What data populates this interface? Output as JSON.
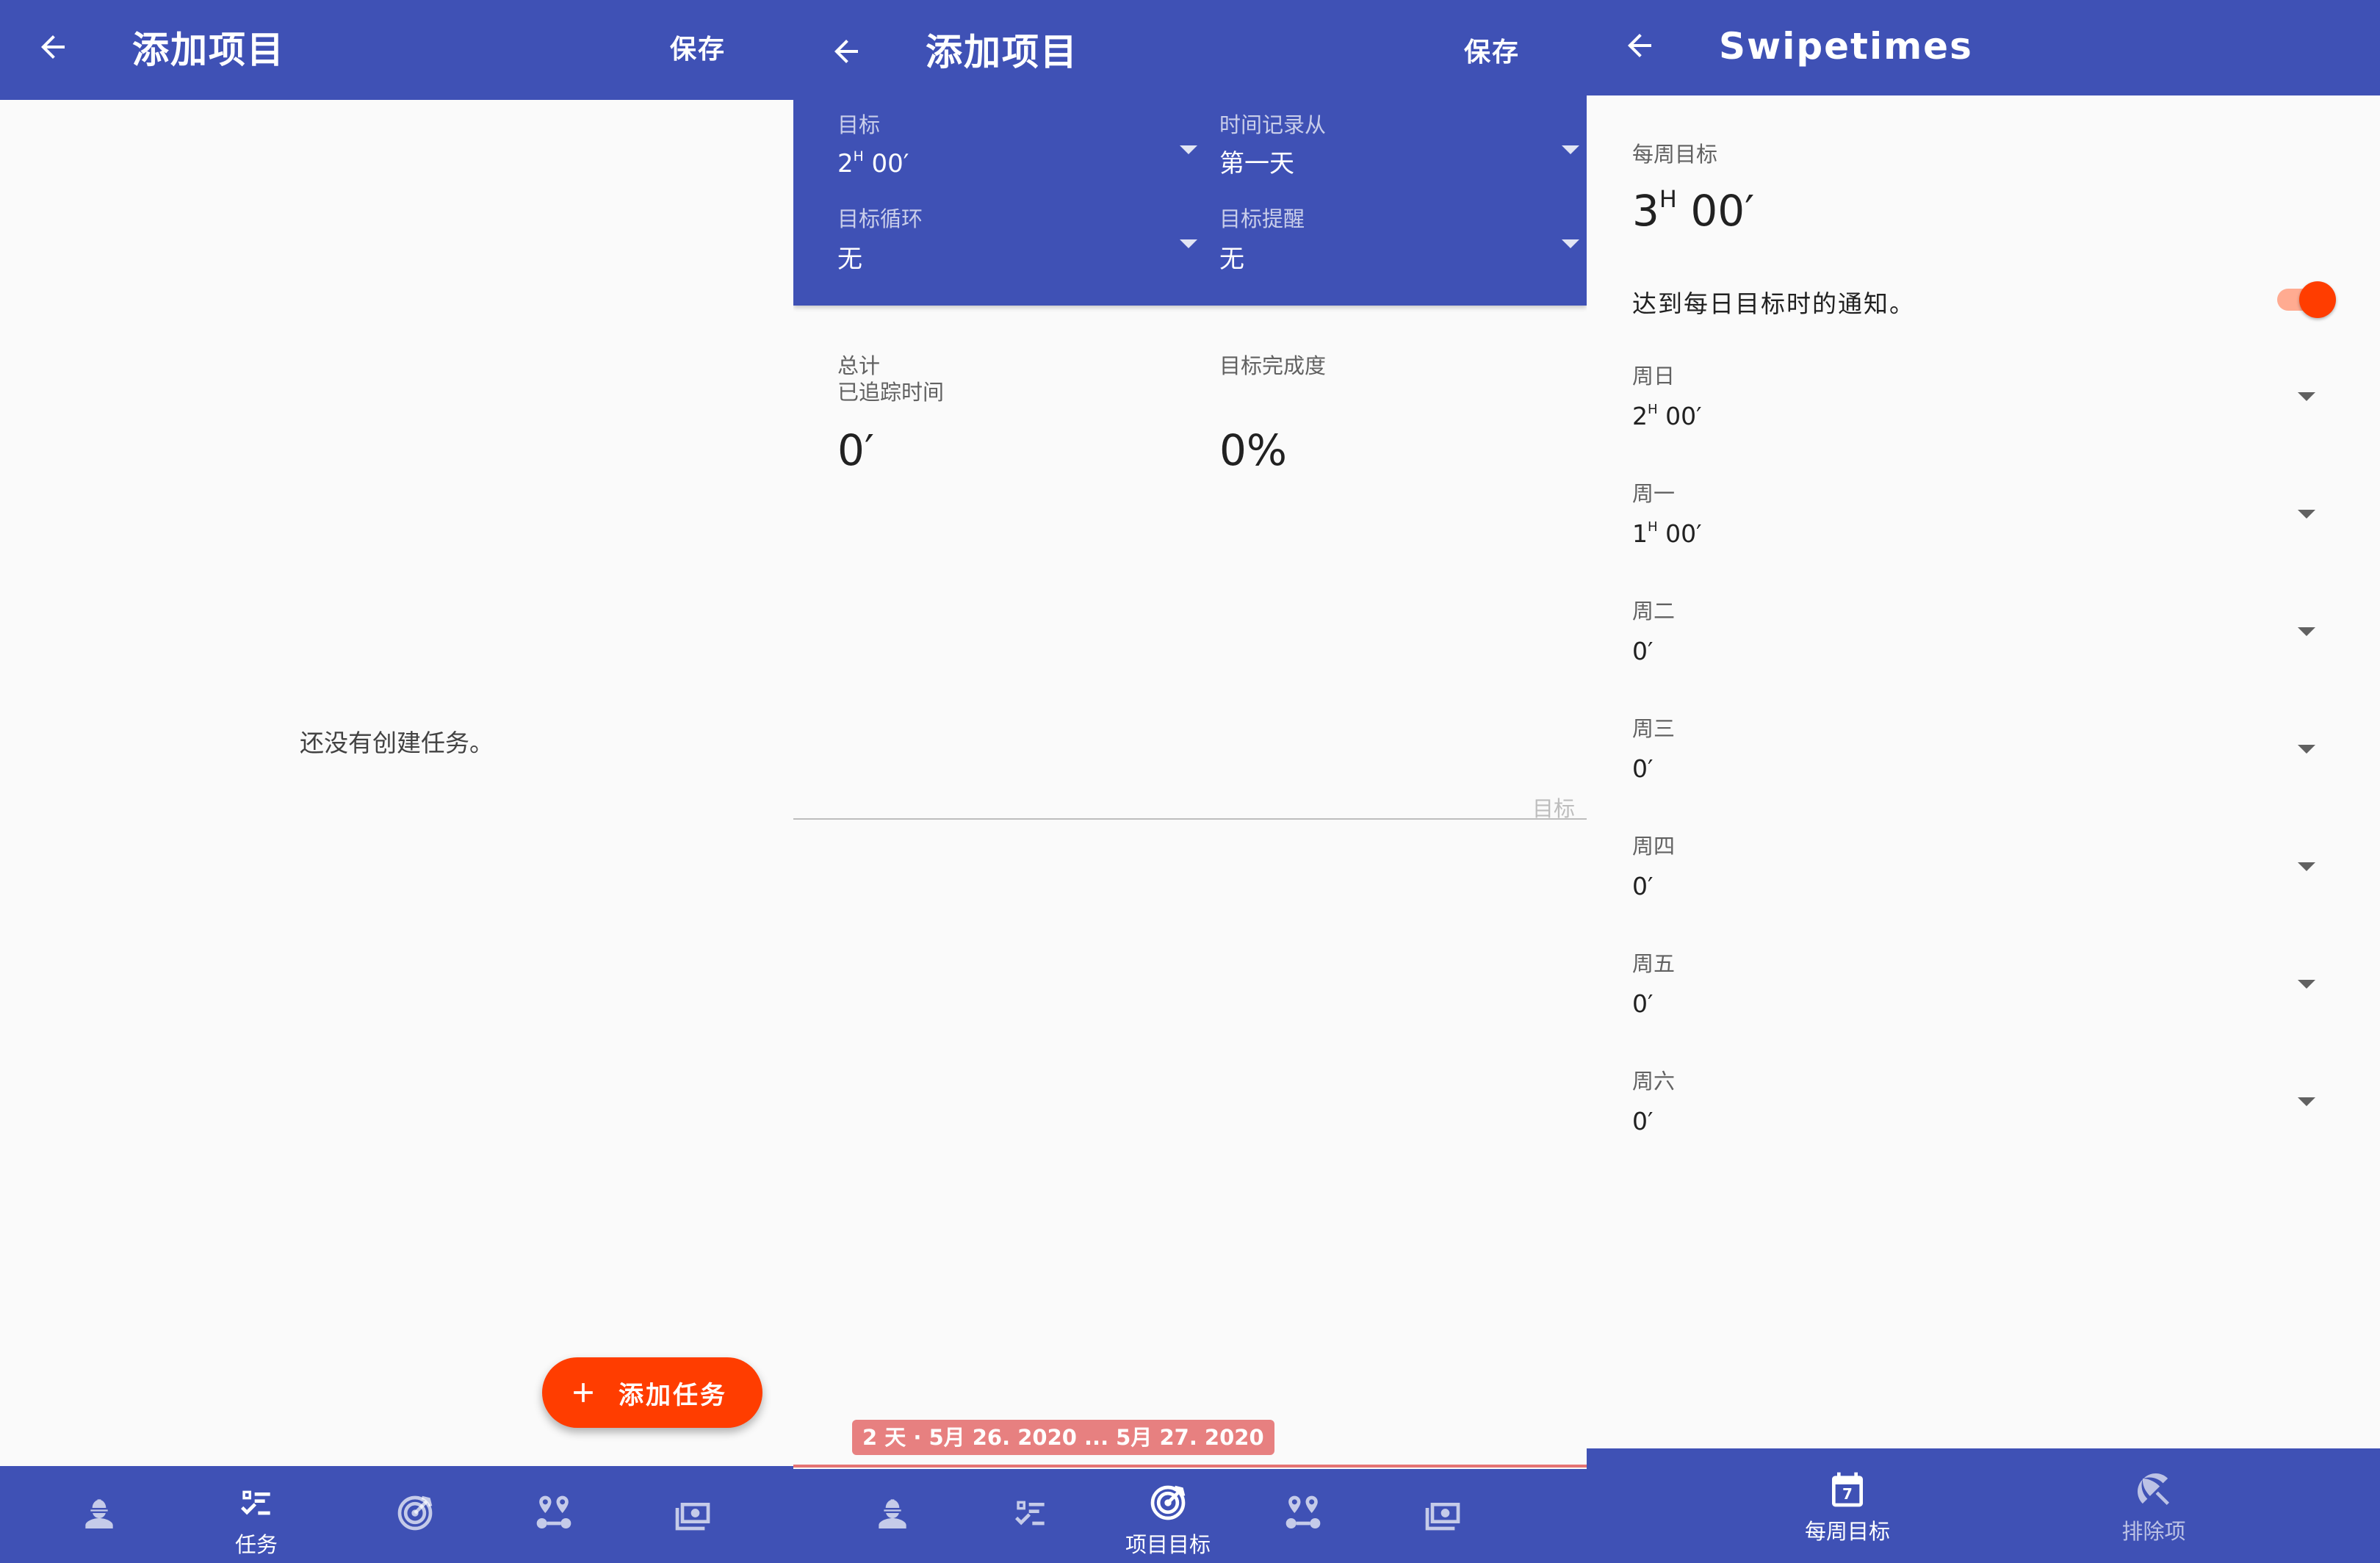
{
  "panel1": {
    "title": "添加项目",
    "save_label": "保存",
    "empty_message": "还没有创建任务。",
    "fab_label": "添加任务",
    "nav": [
      {
        "icon": "worker-icon",
        "label": ""
      },
      {
        "icon": "checklist-icon",
        "label": "任务"
      },
      {
        "icon": "target-icon",
        "label": ""
      },
      {
        "icon": "route-icon",
        "label": ""
      },
      {
        "icon": "money-icon",
        "label": ""
      }
    ]
  },
  "panel2": {
    "title": "添加项目",
    "save_label": "保存",
    "goal_label": "目标",
    "goal_hours": "2",
    "goal_minutes": "00",
    "track_from_label": "时间记录从",
    "track_from_value": "第一天",
    "goal_cycle_label": "目标循环",
    "goal_cycle_value": "无",
    "goal_reminder_label": "目标提醒",
    "goal_reminder_value": "无",
    "total_label_1": "总计",
    "total_label_2": "已追踪时间",
    "total_value": "0",
    "completion_label": "目标完成度",
    "completion_value": "0%",
    "chart_goal_label": "目标",
    "date_range": "2 天 · 5月 26. 2020 ... 5月 27. 2020",
    "nav": [
      {
        "icon": "worker-icon",
        "label": ""
      },
      {
        "icon": "checklist-icon",
        "label": ""
      },
      {
        "icon": "target-icon",
        "label": "项目目标"
      },
      {
        "icon": "route-icon",
        "label": ""
      },
      {
        "icon": "money-icon",
        "label": ""
      }
    ]
  },
  "panel3": {
    "title": "Swipetimes",
    "weekly_goal_label": "每周目标",
    "weekly_goal_hours": "3",
    "weekly_goal_minutes": "00",
    "notify_label": "达到每日目标时的通知。",
    "notify_enabled": true,
    "days": [
      {
        "label": "周日",
        "hours": "2",
        "minutes": "00"
      },
      {
        "label": "周一",
        "hours": "1",
        "minutes": "00"
      },
      {
        "label": "周二",
        "hours": "",
        "minutes": "0"
      },
      {
        "label": "周三",
        "hours": "",
        "minutes": "0"
      },
      {
        "label": "周四",
        "hours": "",
        "minutes": "0"
      },
      {
        "label": "周五",
        "hours": "",
        "minutes": "0"
      },
      {
        "label": "周六",
        "hours": "",
        "minutes": "0"
      }
    ],
    "nav": [
      {
        "icon": "calendar-icon",
        "label": "每周目标",
        "calendar_day": "7"
      },
      {
        "icon": "beach-umbrella-icon",
        "label": "排除项"
      }
    ]
  },
  "colors": {
    "primary": "#3f51b5",
    "accent": "#ff3d00",
    "date_chip": "#e57373",
    "background": "#fafafa"
  }
}
